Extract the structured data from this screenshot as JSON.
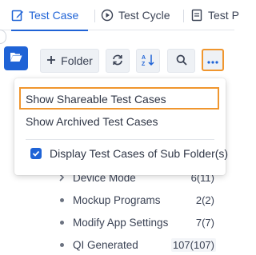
{
  "tabs": [
    {
      "label": "Test Case",
      "active": true,
      "icon": "edit-icon"
    },
    {
      "label": "Test Cycle",
      "active": false,
      "icon": "play-circle-icon"
    },
    {
      "label": "Test P",
      "active": false,
      "icon": "document-icon"
    }
  ],
  "toolbar": {
    "folder_button": "Folder",
    "add_icon": "plus-icon",
    "refresh_icon": "refresh-icon",
    "sort_icon": "sort-icon",
    "search_icon": "search-icon",
    "more_icon": "more-horizontal-icon",
    "folder_toggle_icon": "folder-open-icon"
  },
  "menu": {
    "items": [
      {
        "label": "Show Shareable Test Cases",
        "highlighted": true
      },
      {
        "label": "Show Archived Test Cases"
      }
    ],
    "checkbox_item": {
      "label": "Display Test Cases of Sub Folder(s)",
      "checked": true
    }
  },
  "tree": [
    {
      "name": "Device Mode",
      "count": "6(11)",
      "marker": "chevron-right"
    },
    {
      "name": "Mockup Programs",
      "count": "2(2)",
      "marker": "dot"
    },
    {
      "name": "Modify App Settings",
      "count": "7(7)",
      "marker": "dot"
    },
    {
      "name": "QI Generated",
      "count": "107(107)",
      "marker": "dot"
    }
  ],
  "colors": {
    "accent": "#1f63d6",
    "highlight": "#f0962e"
  }
}
